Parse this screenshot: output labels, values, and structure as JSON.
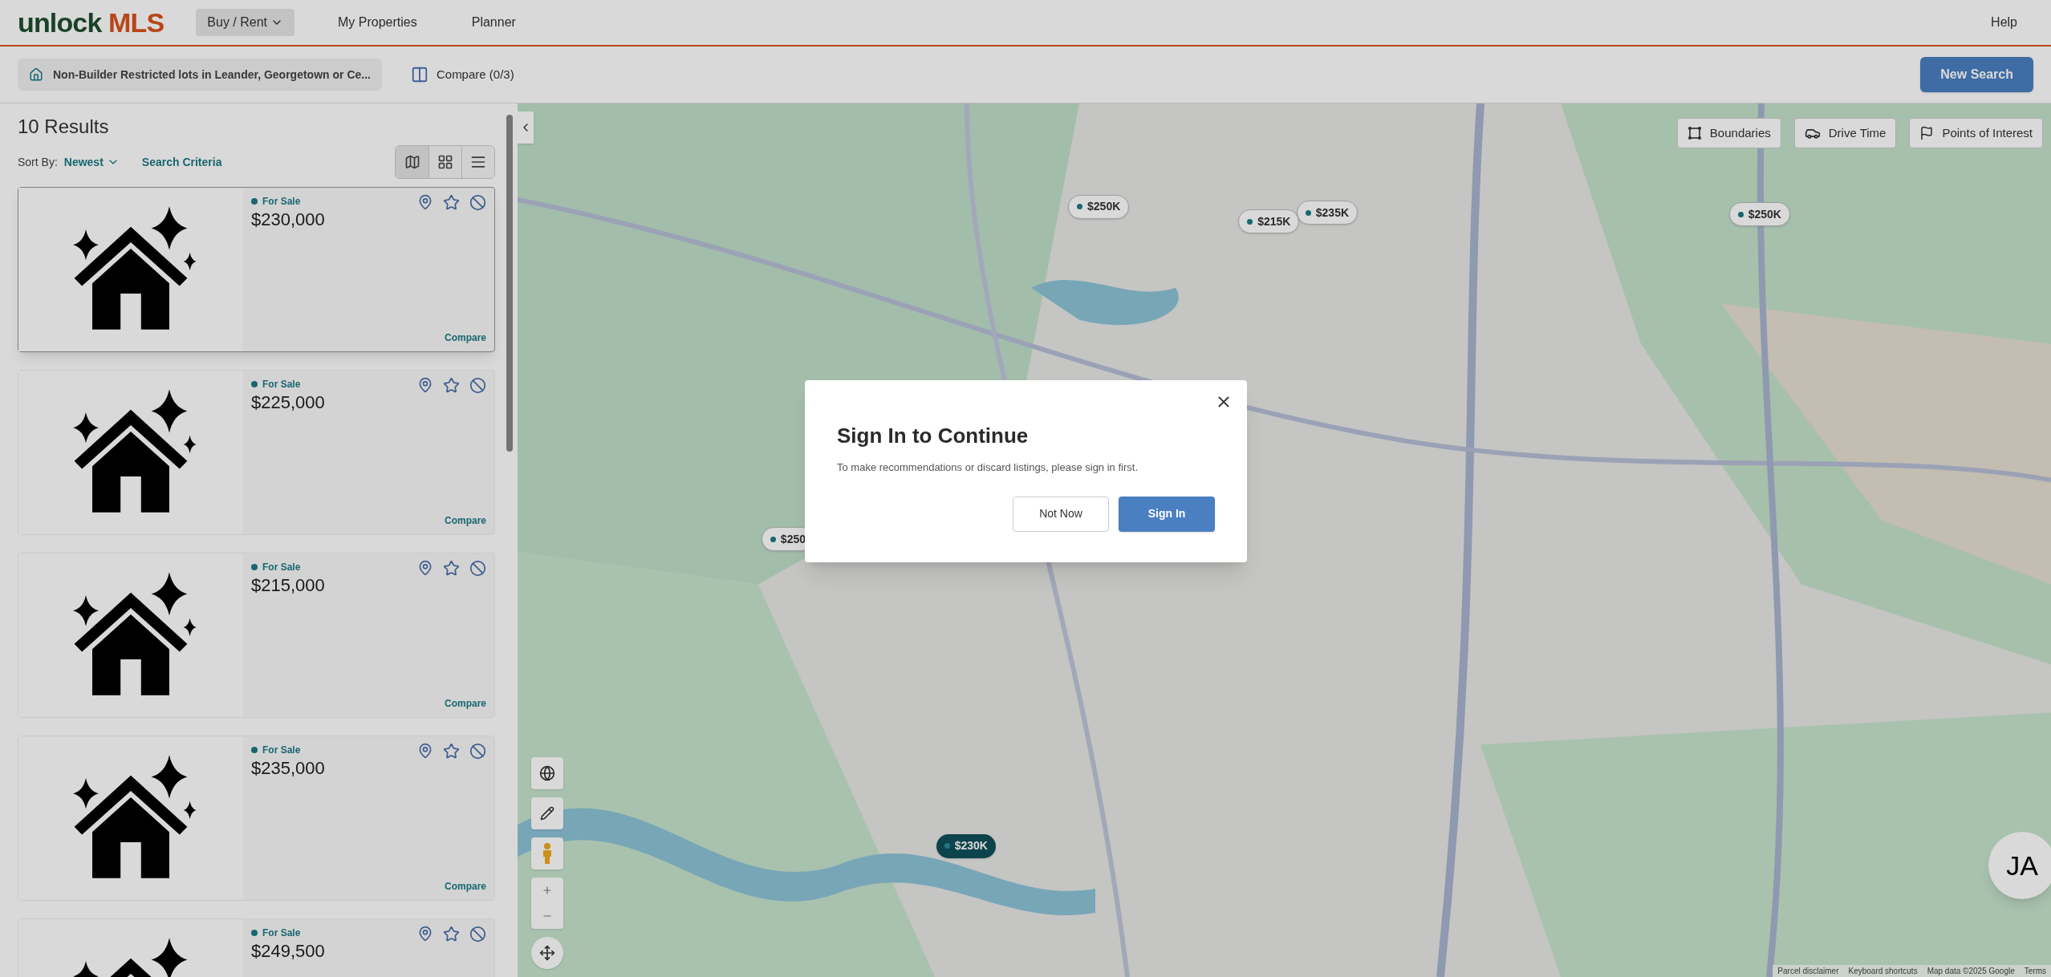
{
  "header": {
    "logo_primary": "unlock",
    "logo_accent": "MLS",
    "nav": [
      {
        "label": "Buy / Rent",
        "kind": "dropdown",
        "selected": true
      },
      {
        "label": "My Properties",
        "kind": "link",
        "selected": false
      },
      {
        "label": "Planner",
        "kind": "link",
        "selected": false
      }
    ],
    "help": "Help"
  },
  "toolbar": {
    "saved_search": "Non-Builder Restricted lots in Leander, Georgetown or Ce...",
    "compare": "Compare (0/3)",
    "new_search": "New Search"
  },
  "results": {
    "count": "10 Results",
    "sort_label": "Sort By:",
    "sort_value": "Newest",
    "criteria": "Search Criteria",
    "views": [
      {
        "kind": "map",
        "selected": true
      },
      {
        "kind": "grid",
        "selected": false
      },
      {
        "kind": "list",
        "selected": false
      }
    ]
  },
  "listings": [
    {
      "status": "For Sale",
      "price": "$230,000",
      "compare": "Compare",
      "selected": true
    },
    {
      "status": "For Sale",
      "price": "$225,000",
      "compare": "Compare",
      "selected": false
    },
    {
      "status": "For Sale",
      "price": "$215,000",
      "compare": "Compare",
      "selected": false
    },
    {
      "status": "For Sale",
      "price": "$235,000",
      "compare": "Compare",
      "selected": false
    },
    {
      "status": "For Sale",
      "price": "$249,500",
      "selected": false
    }
  ],
  "map": {
    "tools": [
      {
        "label": "Boundaries",
        "kind": "boundaries"
      },
      {
        "label": "Drive Time",
        "kind": "drive"
      },
      {
        "label": "Points of Interest",
        "kind": "poi"
      }
    ],
    "markers": [
      {
        "label": "$250K",
        "selected": false
      },
      {
        "label": "$215K",
        "selected": false
      },
      {
        "label": "$235K",
        "selected": false
      },
      {
        "label": "$250K",
        "selected": false
      },
      {
        "label": "$250",
        "selected": false
      },
      {
        "label": "$230K",
        "selected": true
      }
    ],
    "attribution": [
      "Parcel disclaimer",
      "Keyboard shortcuts",
      "Map data ©2025 Google",
      "Terms"
    ],
    "avatar": "JA"
  },
  "modal": {
    "title": "Sign In to Continue",
    "message": "To make recommendations or discard listings, please sign in first.",
    "buttons": [
      {
        "label": "Not Now",
        "kind": "secondary"
      },
      {
        "label": "Sign In",
        "kind": "primary"
      }
    ]
  }
}
